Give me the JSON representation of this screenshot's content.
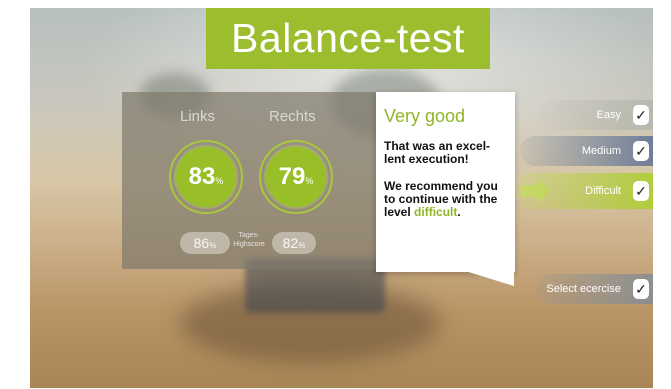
{
  "title": "Balance-test",
  "results": {
    "left_label": "Links",
    "right_label": "Rechts",
    "left_score": "83",
    "right_score": "79",
    "score_unit": "%",
    "left_highscore": "86",
    "right_highscore": "82",
    "highscore_unit": "%",
    "highscore_caption_1": "Tages-",
    "highscore_caption_2": "Highscore"
  },
  "feedback": {
    "title": "Very good",
    "message_1": "That was an excel-lent execution!",
    "message_2_pre": "We recommend you to continue with the level ",
    "message_2_level": "difficult",
    "message_2_post": "."
  },
  "levels": [
    {
      "label": "Easy",
      "checked": true
    },
    {
      "label": "Medium",
      "checked": true
    },
    {
      "label": "Difficult",
      "checked": true,
      "selected": true
    }
  ],
  "select_exercise": "Select ecercise",
  "check_glyph": "✓",
  "colors": {
    "accent": "#9cbd2e"
  }
}
